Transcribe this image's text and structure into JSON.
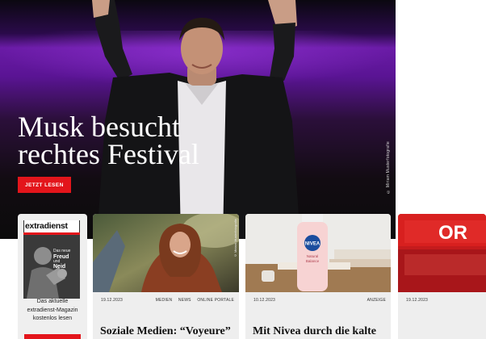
{
  "hero": {
    "title_line1": "Musk besucht",
    "title_line2": "rechtes Festival",
    "cta_label": "JETZT LESEN",
    "photo_credit": "© Miriam Musterfotografie"
  },
  "cards": [
    {
      "type": "magazine",
      "cover_brand": "extradienst",
      "cover_headline_lines": [
        "Das neue",
        "Freud",
        "und",
        "Neid"
      ],
      "text": "Das aktuelle extradienst-Magazin kostenlos lesen"
    },
    {
      "date": "19.12.2023",
      "tags": [
        "MEDIEN",
        "NEWS",
        "ONLINE PORTALE"
      ],
      "title": "Soziale Medien: “Voyeure”",
      "photo_credit": "© Miriam Musterfotografie"
    },
    {
      "date": "10.12.2023",
      "tags": [
        "ANZEIGE"
      ],
      "title": "Mit Nivea durch die kalte",
      "product_brand": "NIVEA",
      "product_lines": [
        "Natural",
        "Balance"
      ]
    },
    {
      "date": "19.12.2023",
      "tags": [],
      "sign_text": "OR"
    }
  ],
  "colors": {
    "accent_red": "#e3151b",
    "hero_purple": "#6a1ba6",
    "card_bg": "#eeeeee"
  }
}
